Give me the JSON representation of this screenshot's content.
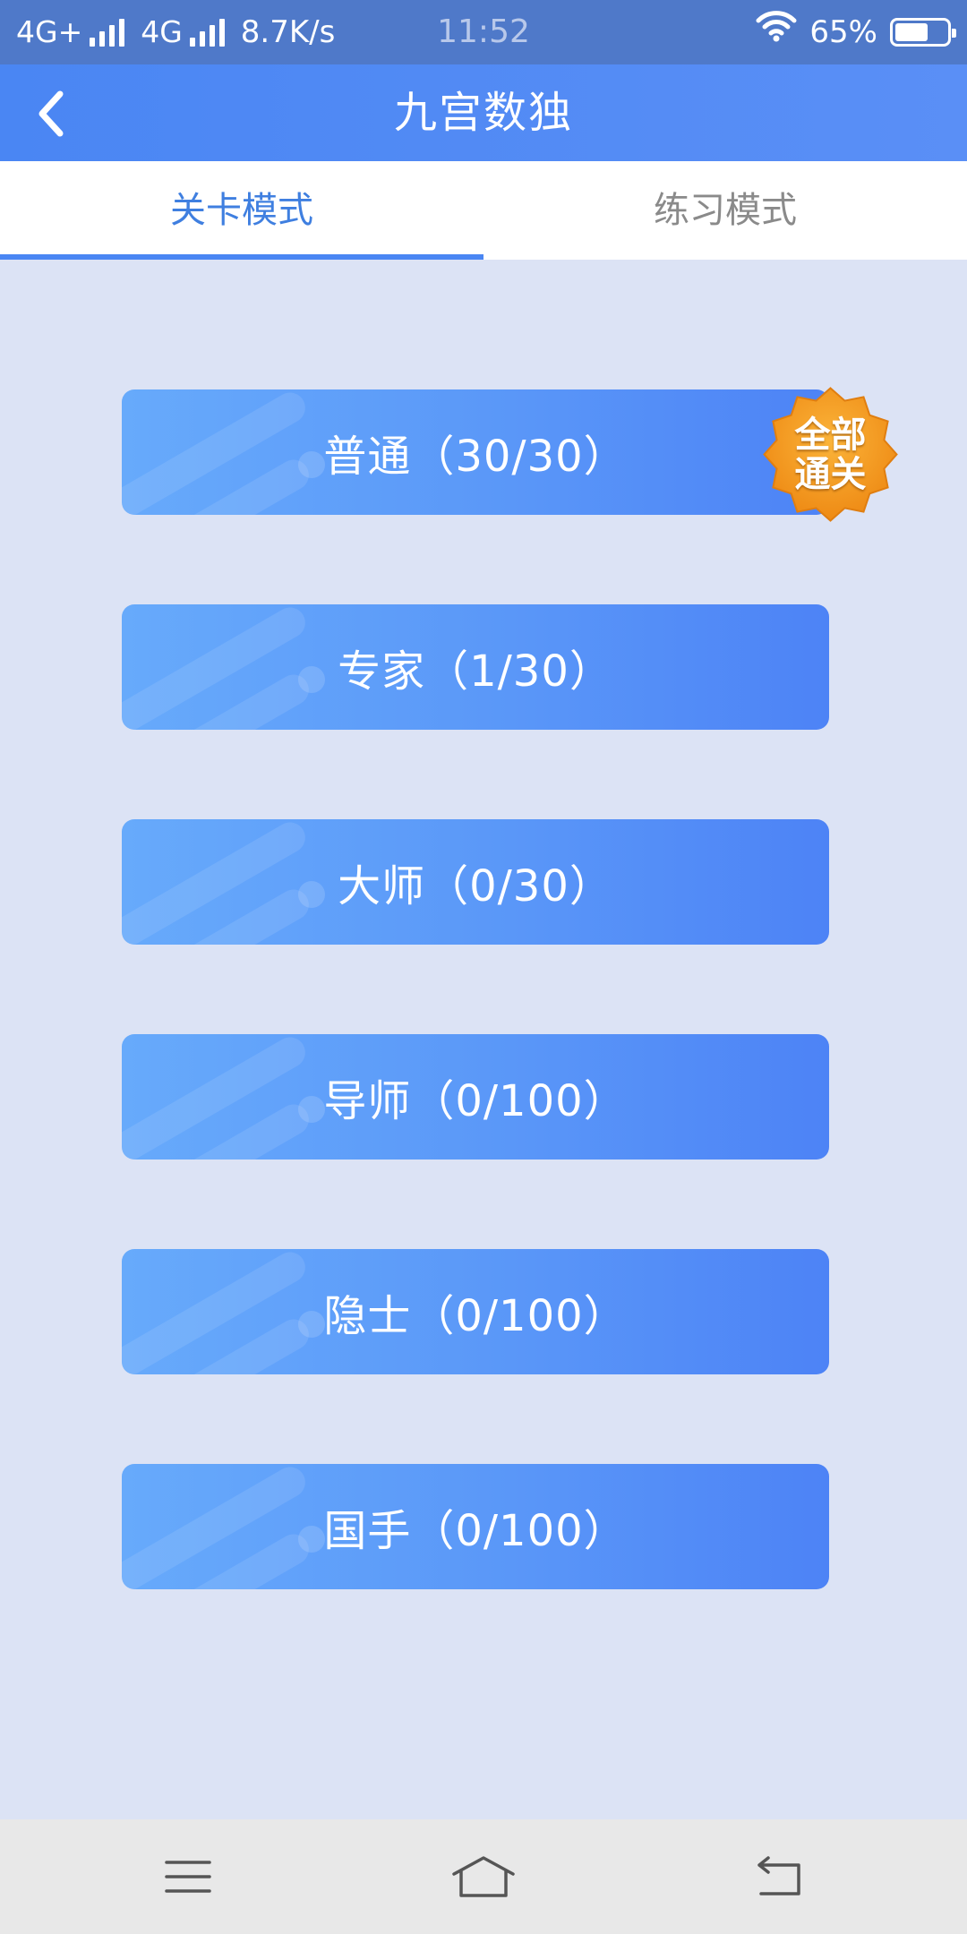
{
  "status_bar": {
    "network1": "4G+",
    "network2": "4G",
    "speed": "8.7K/s",
    "time": "11:52",
    "battery": "65%",
    "battery_level": 0.65
  },
  "header": {
    "title": "九宫数独"
  },
  "tabs": [
    {
      "label": "关卡模式",
      "active": true
    },
    {
      "label": "练习模式",
      "active": false
    }
  ],
  "levels": [
    {
      "label": "普通（30/30）"
    },
    {
      "label": "专家（1/30）"
    },
    {
      "label": "大师（0/30）"
    },
    {
      "label": "导师（0/100）"
    },
    {
      "label": "隐士（0/100）"
    },
    {
      "label": "国手（0/100）"
    }
  ],
  "badge": {
    "line1": "全部",
    "line2": "通关"
  },
  "colors": {
    "accent": "#4a86f3",
    "badge": "#f39a1f",
    "background": "#dce3f5"
  },
  "icons": {
    "back": "chevron-left-icon",
    "menu": "menu-icon",
    "home": "home-icon",
    "return": "return-icon",
    "wifi": "wifi-icon"
  }
}
